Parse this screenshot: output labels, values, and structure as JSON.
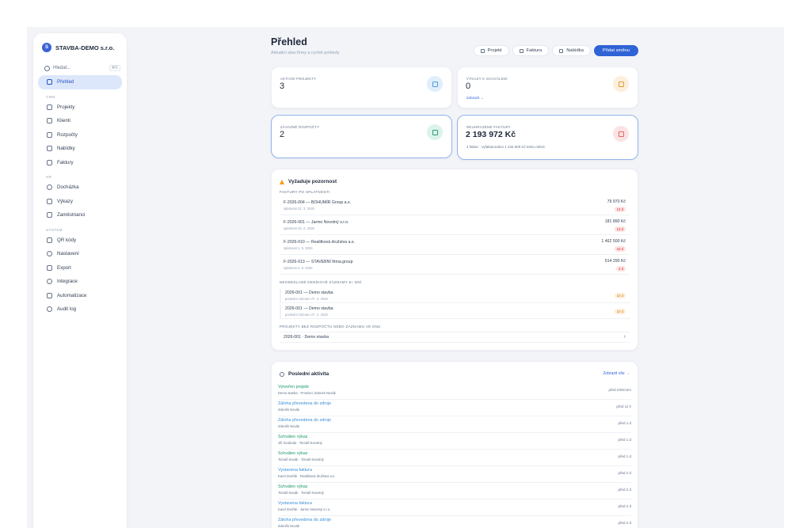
{
  "sidebar": {
    "brand_logo": "S",
    "brand_name": "STAVBA-DEMO s.r.o.",
    "search_placeholder": "Hledat...",
    "search_shortcut": "⌘K",
    "items": [
      {
        "label": "Přehled",
        "icon": "dashboard-icon"
      },
      {
        "label": "Projekty",
        "icon": "building-icon"
      },
      {
        "label": "Klienti",
        "icon": "clients-icon"
      },
      {
        "label": "Rozpočty",
        "icon": "budget-icon"
      },
      {
        "label": "Nabídky",
        "icon": "offer-icon"
      },
      {
        "label": "Faktury",
        "icon": "invoice-icon"
      },
      {
        "label": "Docházka",
        "icon": "clock-icon"
      },
      {
        "label": "Výkazy",
        "icon": "report-icon"
      },
      {
        "label": "Zaměstnanci",
        "icon": "people-icon"
      },
      {
        "label": "QR kódy",
        "icon": "qr-icon"
      },
      {
        "label": "Nastavení",
        "icon": "gear-icon"
      },
      {
        "label": "Export",
        "icon": "export-icon"
      },
      {
        "label": "Integrace",
        "icon": "integration-icon"
      },
      {
        "label": "Automatizace",
        "icon": "automation-icon"
      },
      {
        "label": "Audit log",
        "icon": "history-icon"
      }
    ],
    "section_1": "CRM",
    "section_2": "HR",
    "section_3": "SYSTEM"
  },
  "header": {
    "title": "Přehled",
    "subtitle": "Aktuální stav firmy a rychlé pohledy",
    "actions": [
      {
        "label": "Projekt"
      },
      {
        "label": "Faktura"
      },
      {
        "label": "Nabídka"
      },
      {
        "label": "Přidat směnu"
      }
    ]
  },
  "stats": [
    {
      "label": "AKTIVNÍ PROJEKTY",
      "value": "3",
      "sub": "",
      "icon_color": "#4f9bd8",
      "bg": "#e0eefb"
    },
    {
      "label": "VÝKAZY K SCHVÁLENÍ",
      "value": "0",
      "sub": "Zobrazit →",
      "icon_color": "#e39a3a",
      "bg": "#fcefdc"
    },
    {
      "label": "ZÁVAZNÉ ROZPOČTY",
      "value": "2",
      "sub": "",
      "icon_color": "#2f9a78",
      "bg": "#dcf3ea"
    },
    {
      "label": "NEUHRAZENÉ FAKTURY",
      "value": "2 193 972 Kč",
      "sub": "4 faktur · vyfakturováno 1 234 500 Kč tento měsíc",
      "icon_color": "#e06363",
      "bg": "#fce3e3"
    }
  ],
  "attention": {
    "title": "Vyžaduje pozornost",
    "overdue_heading": "FAKTURY PO SPLATNOSTI",
    "invoices": [
      {
        "title": "F-2026-004 — BOHUMÍR Group a.s.",
        "sub": "splatnost 22. 3. 2026",
        "amount": "79 970 Kč",
        "badge": "12 d"
      },
      {
        "title": "F-2026-001 — Jarmo Novotný s.r.o.",
        "sub": "splatnost 15. 4. 2026",
        "amount": "181 890 Kč",
        "badge": "13 d"
      },
      {
        "title": "F-2026-010 — Realitková družstva a.s.",
        "sub": "splatnost 1. 5. 2026",
        "amount": "1 462 500 Kč",
        "badge": "10 d"
      },
      {
        "title": "F-2026-013 — STAVEBNÍ firma.group",
        "sub": "splatnost 4. 5. 2026",
        "amount": "514 290 Kč",
        "badge": "4 d"
      }
    ],
    "stale_heading": "NEODESLANÉ DENÍKOVÉ ZÁZNAMY 5+ DNÍ",
    "stale": [
      {
        "title": "2026-001 — Demo stavba",
        "sub": "poslední záznam 27. 4. 2026",
        "badge": "10 d"
      },
      {
        "title": "2026-001 — Demo stavba",
        "sub": "poslední záznam 27. 4. 2026",
        "badge": "10 d"
      }
    ],
    "projects_heading": "PROJEKTY BEZ ROZPOČTU NEBO ZÁZNAMU VE DNU",
    "projects": [
      {
        "title": "2026-001 · Demo stavba"
      }
    ]
  },
  "activity": {
    "title": "Poslední aktivita",
    "link": "Zobrazit vše →",
    "rows": [
      {
        "title": "Vytvořen projekt",
        "desc": "Demo stavba · Prosinec Zdenek Novák",
        "time": "před měsícem",
        "tone": "green"
      },
      {
        "title": "Záloha převedena do zdroje",
        "desc": "Zdeněk Novák",
        "time": "před 11 h",
        "tone": "blue"
      },
      {
        "title": "Záloha převedena do zdroje",
        "desc": "Zdeněk Novák",
        "time": "před 1 d",
        "tone": "blue"
      },
      {
        "title": "Schválen výkaz",
        "desc": "Jiří Svoboda · Tomáš Novotný",
        "time": "před 1 d",
        "tone": "green"
      },
      {
        "title": "Schválen výkaz",
        "desc": "Tomáš Novák · Tomáš Novotný",
        "time": "před 1 d",
        "tone": "green"
      },
      {
        "title": "Vystavena faktura",
        "desc": "Karel Dvořák · Realitková družstva a.s.",
        "time": "před 2 d",
        "tone": "blue"
      },
      {
        "title": "Schválen výkaz",
        "desc": "Tomáš Novák · Tomáš Novotný",
        "time": "před 2 d",
        "tone": "green"
      },
      {
        "title": "Vystavena faktura",
        "desc": "Karel Dvořák · Jarmo Novotný s.r.o.",
        "time": "před 2 d",
        "tone": "blue"
      },
      {
        "title": "Záloha převedena do zdroje",
        "desc": "Zdeněk Novák",
        "time": "před 2 d",
        "tone": "blue"
      }
    ]
  }
}
